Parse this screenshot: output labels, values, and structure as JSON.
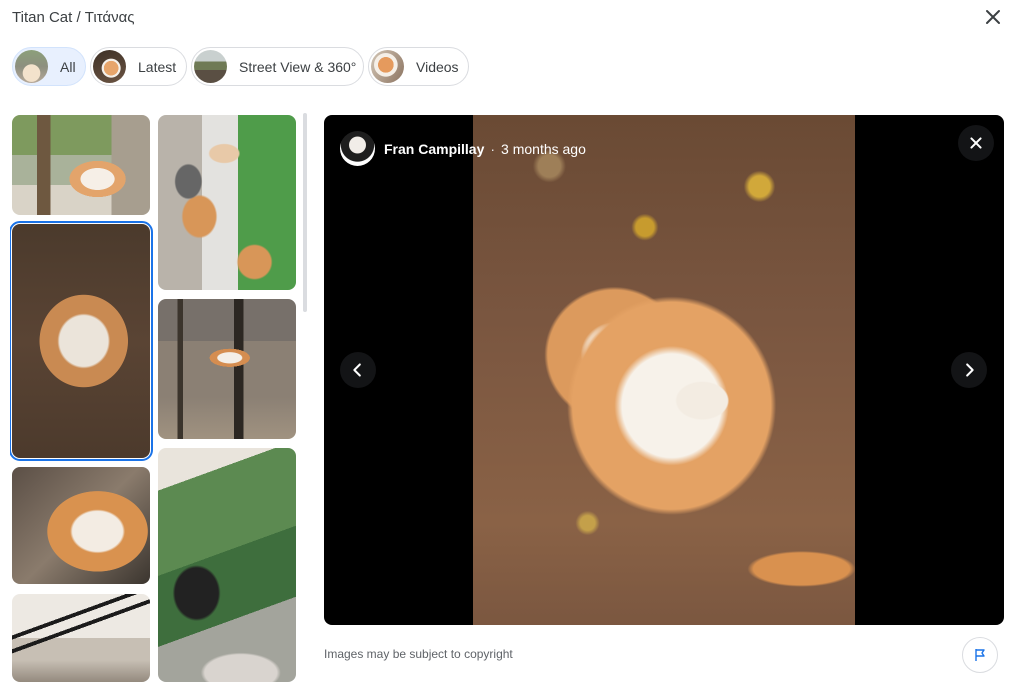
{
  "header": {
    "title": "Titan Cat / Τιτάνας",
    "close_icon": "close-icon"
  },
  "filters": [
    {
      "label": "All",
      "active": true
    },
    {
      "label": "Latest",
      "active": false
    },
    {
      "label": "Street View & 360°",
      "active": false
    },
    {
      "label": "Videos",
      "active": false
    }
  ],
  "viewer": {
    "author": "Fran Campillay",
    "separator": "·",
    "time_ago": "3 months ago"
  },
  "footer": {
    "copyright": "Images may be subject to copyright",
    "report_icon": "flag-icon"
  },
  "colors": {
    "accent": "#1a73e8",
    "active_chip_bg": "#e8f0fe"
  }
}
